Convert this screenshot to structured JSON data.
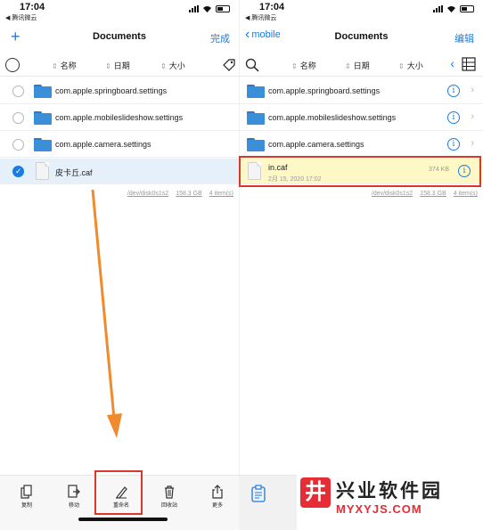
{
  "left": {
    "status": {
      "time": "17:04",
      "carrier": "◀ 腾讯微云"
    },
    "nav": {
      "add_symbol": "+",
      "title": "Documents",
      "done_label": "完成"
    },
    "sort": {
      "name": "名称",
      "date": "日期",
      "size": "大小"
    },
    "rows": [
      {
        "label": "com.apple.springboard.settings",
        "type": "folder",
        "selected": false
      },
      {
        "label": "com.apple.mobileslideshow.settings",
        "type": "folder",
        "selected": false
      },
      {
        "label": "com.apple.camera.settings",
        "type": "folder",
        "selected": false
      },
      {
        "label": "皮卡丘.caf",
        "type": "file",
        "selected": true
      }
    ],
    "footer": {
      "disk": "/dev/disk0s1s2",
      "space": "158.3 GB",
      "items": "4 item(s)"
    },
    "toolbar": [
      {
        "label": "复制",
        "icon": "copy-icon"
      },
      {
        "label": "移动",
        "icon": "move-icon"
      },
      {
        "label": "重命名",
        "icon": "rename-icon"
      },
      {
        "label": "回收站",
        "icon": "trash-icon"
      },
      {
        "label": "更多",
        "icon": "share-icon"
      }
    ]
  },
  "right": {
    "status": {
      "time": "17:04",
      "carrier": "◀ 腾讯微云"
    },
    "nav": {
      "back_label": "mobile",
      "title": "Documents",
      "edit_label": "编辑"
    },
    "sort": {
      "name": "名称",
      "date": "日期",
      "size": "大小"
    },
    "rows": [
      {
        "label": "com.apple.springboard.settings",
        "type": "folder"
      },
      {
        "label": "com.apple.mobileslideshow.settings",
        "type": "folder"
      },
      {
        "label": "com.apple.camera.settings",
        "type": "folder"
      },
      {
        "label": "in.caf",
        "type": "file",
        "date": "2月 15, 2020 17:02",
        "size": "374 KB"
      }
    ],
    "footer": {
      "disk": "/dev/disk0s1s2",
      "space": "158.3 GB",
      "items": "4 item(s)"
    }
  },
  "watermark": {
    "logo_char": "井",
    "name_cn": "兴业软件园",
    "name_en": "MYXYJS.COM"
  },
  "colors": {
    "accent": "#1a7ce0",
    "highlight_border": "#d9362c",
    "arrow": "#f08a2c",
    "watermark_red": "#e62c35"
  }
}
